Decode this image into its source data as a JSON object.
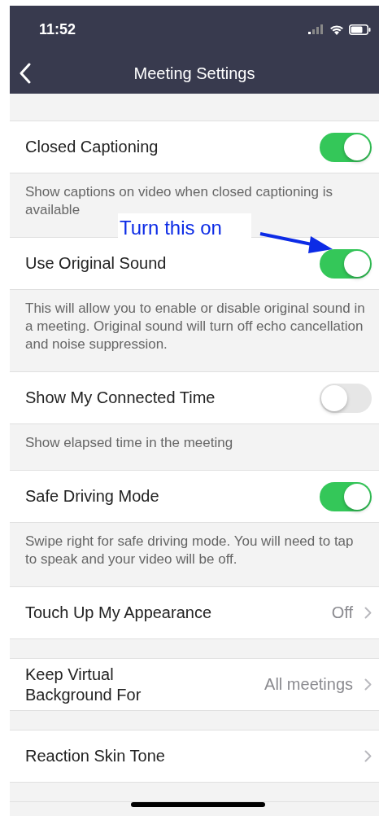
{
  "status_bar": {
    "time": "11:52"
  },
  "nav": {
    "title": "Meeting Settings"
  },
  "settings": [
    {
      "kind": "toggle",
      "label": "Closed Captioning",
      "on": true,
      "description": "Show captions on video when closed captioning is available"
    },
    {
      "kind": "toggle",
      "label": "Use Original Sound",
      "on": true,
      "description": "This will allow you to enable or disable original sound in a meeting. Original sound will turn off echo cancellation and noise suppression."
    },
    {
      "kind": "toggle",
      "label": "Show My Connected Time",
      "on": false,
      "description": "Show elapsed time in the meeting"
    },
    {
      "kind": "toggle",
      "label": "Safe Driving Mode",
      "on": true,
      "description": "Swipe right for safe driving mode. You will need to tap to speak and your video will be off."
    },
    {
      "kind": "link",
      "label": "Touch Up My Appearance",
      "value": "Off"
    },
    {
      "kind": "link",
      "label": "Keep Virtual Background For",
      "value": "All meetings"
    },
    {
      "kind": "link",
      "label": "Reaction Skin Tone"
    }
  ],
  "annotation": {
    "text": "Turn this on"
  }
}
